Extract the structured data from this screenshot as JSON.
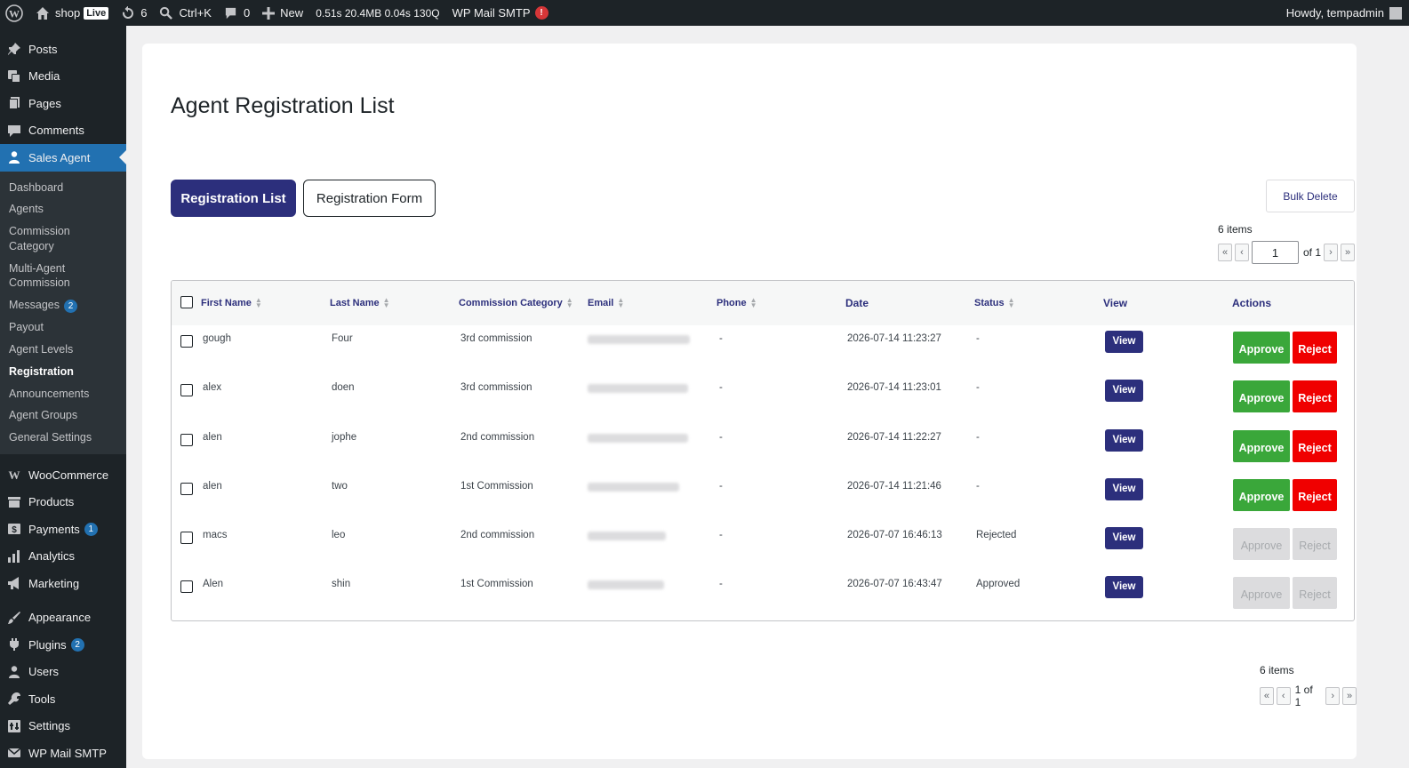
{
  "adminbar": {
    "site_name": "shop",
    "live_badge": "Live",
    "updates_count": "6",
    "search_shortcut": "Ctrl+K",
    "comments_count": "0",
    "new_label": "New",
    "perf": "0.51s  20.4MB  0.04s  130Q",
    "smtp_label": "WP Mail SMTP",
    "smtp_alert": "!",
    "greeting": "Howdy, tempadmin"
  },
  "sidebar": {
    "top_items": [
      {
        "label": "Posts",
        "icon": "pin-icon"
      },
      {
        "label": "Media",
        "icon": "media-icon"
      },
      {
        "label": "Pages",
        "icon": "pages-icon"
      },
      {
        "label": "Comments",
        "icon": "comment-icon"
      }
    ],
    "active_item": {
      "label": "Sales Agent",
      "icon": "users-icon"
    },
    "submenu": [
      {
        "label": "Dashboard"
      },
      {
        "label": "Agents"
      },
      {
        "label": "Commission Category"
      },
      {
        "label": "Multi-Agent Commission"
      },
      {
        "label": "Messages",
        "badge": "2"
      },
      {
        "label": "Payout"
      },
      {
        "label": "Agent Levels"
      },
      {
        "label": "Registration",
        "current": true
      },
      {
        "label": "Announcements"
      },
      {
        "label": "Agent Groups"
      },
      {
        "label": "General Settings"
      }
    ],
    "group2": [
      {
        "label": "WooCommerce",
        "icon": "woo-icon"
      },
      {
        "label": "Products",
        "icon": "archive-icon"
      },
      {
        "label": "Payments",
        "icon": "payments-icon",
        "badge": "1"
      },
      {
        "label": "Analytics",
        "icon": "chart-icon"
      },
      {
        "label": "Marketing",
        "icon": "megaphone-icon"
      }
    ],
    "group3": [
      {
        "label": "Appearance",
        "icon": "brush-icon"
      },
      {
        "label": "Plugins",
        "icon": "plugin-icon",
        "badge": "2"
      },
      {
        "label": "Users",
        "icon": "user-icon"
      },
      {
        "label": "Tools",
        "icon": "wrench-icon"
      },
      {
        "label": "Settings",
        "icon": "settings-icon"
      },
      {
        "label": "WP Mail SMTP",
        "icon": "mail-icon"
      }
    ]
  },
  "page": {
    "title": "Agent Registration List",
    "tab_list": "Registration List",
    "tab_form": "Registration Form",
    "bulk_delete": "Bulk Delete",
    "items_count": "6 items",
    "page_input": "1",
    "of_pages": "of 1",
    "bottom_pages": "1 of 1",
    "first": "«",
    "prev": "‹",
    "next": "›",
    "last": "»"
  },
  "table": {
    "headers": {
      "first_name": "First Name",
      "last_name": "Last Name",
      "category": "Commission Category",
      "email": "Email",
      "phone": "Phone",
      "date": "Date",
      "status": "Status",
      "view": "View",
      "actions": "Actions"
    },
    "view_label": "View",
    "approve_label": "Approve",
    "reject_label": "Reject",
    "rows": [
      {
        "first": "gough",
        "last": "Four",
        "category": "3rd commission",
        "phone": "-",
        "date": "2026-07-14 11:23:27",
        "status": "-",
        "actions_enabled": true
      },
      {
        "first": "alex",
        "last": "doen",
        "category": "3rd commission",
        "phone": "-",
        "date": "2026-07-14 11:23:01",
        "status": "-",
        "actions_enabled": true
      },
      {
        "first": "alen",
        "last": "jophe",
        "category": "2nd commission",
        "phone": "-",
        "date": "2026-07-14 11:22:27",
        "status": "-",
        "actions_enabled": true
      },
      {
        "first": "alen",
        "last": "two",
        "category": "1st Commission",
        "phone": "-",
        "date": "2026-07-14 11:21:46",
        "status": "-",
        "actions_enabled": true
      },
      {
        "first": "macs",
        "last": "leo",
        "category": "2nd commission",
        "phone": "-",
        "date": "2026-07-07 16:46:13",
        "status": "Rejected",
        "actions_enabled": false
      },
      {
        "first": "Alen",
        "last": "shin",
        "category": "1st Commission",
        "phone": "-",
        "date": "2026-07-07 16:43:47",
        "status": "Approved",
        "actions_enabled": false
      }
    ]
  },
  "colors": {
    "primary": "#2c2f7c",
    "approve": "#3aa73a",
    "reject": "#f00000",
    "wp_active": "#2271b1",
    "admin_bg": "#1d2327"
  }
}
